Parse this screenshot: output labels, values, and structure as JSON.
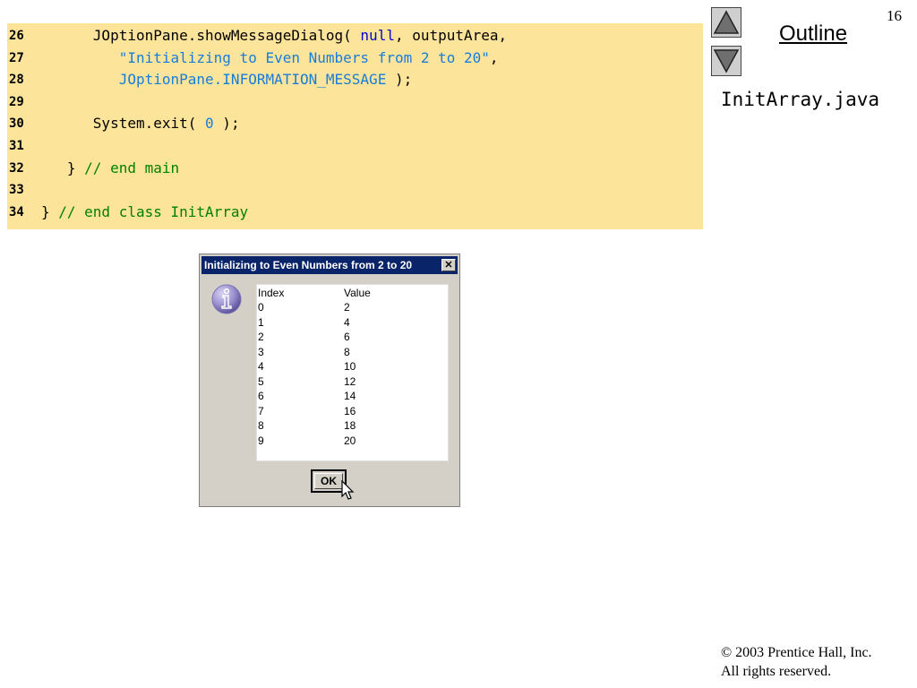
{
  "page_number": "16",
  "outline_label": "Outline",
  "file_name": "InitArray.java",
  "code_lines": [
    {
      "num": "26",
      "indent": "      ",
      "parts": [
        {
          "t": "JOptionPane.showMessageDialog( ",
          "c": ""
        },
        {
          "t": "null",
          "c": "kw"
        },
        {
          "t": ", outputArea,",
          "c": ""
        }
      ]
    },
    {
      "num": "27",
      "indent": "         ",
      "parts": [
        {
          "t": "\"Initializing to Even Numbers from 2 to 20\"",
          "c": "str"
        },
        {
          "t": ",",
          "c": ""
        }
      ]
    },
    {
      "num": "28",
      "indent": "         ",
      "parts": [
        {
          "t": "JOptionPane.INFORMATION_MESSAGE",
          "c": "str"
        },
        {
          "t": " );",
          "c": ""
        }
      ]
    },
    {
      "num": "29",
      "indent": "",
      "parts": []
    },
    {
      "num": "30",
      "indent": "      ",
      "parts": [
        {
          "t": "System.exit( ",
          "c": ""
        },
        {
          "t": "0",
          "c": "num"
        },
        {
          "t": " );",
          "c": ""
        }
      ]
    },
    {
      "num": "31",
      "indent": "",
      "parts": []
    },
    {
      "num": "32",
      "indent": "   ",
      "parts": [
        {
          "t": "} ",
          "c": ""
        },
        {
          "t": "// end main",
          "c": "cmt"
        }
      ]
    },
    {
      "num": "33",
      "indent": "",
      "parts": []
    },
    {
      "num": "34",
      "indent": "",
      "parts": [
        {
          "t": "} ",
          "c": ""
        },
        {
          "t": "// end class InitArray",
          "c": "cmt"
        }
      ]
    }
  ],
  "dialog": {
    "title": "Initializing to Even Numbers from 2 to 20",
    "close_label": "✕",
    "ok_label": "OK",
    "columns": [
      "Index",
      "Value"
    ],
    "rows": [
      [
        "0",
        "2"
      ],
      [
        "1",
        "4"
      ],
      [
        "2",
        "6"
      ],
      [
        "3",
        "8"
      ],
      [
        "4",
        "10"
      ],
      [
        "5",
        "12"
      ],
      [
        "6",
        "14"
      ],
      [
        "7",
        "16"
      ],
      [
        "8",
        "18"
      ],
      [
        "9",
        "20"
      ]
    ]
  },
  "copyright": {
    "line1": "© 2003 Prentice Hall, Inc.",
    "line2": "All rights reserved."
  }
}
